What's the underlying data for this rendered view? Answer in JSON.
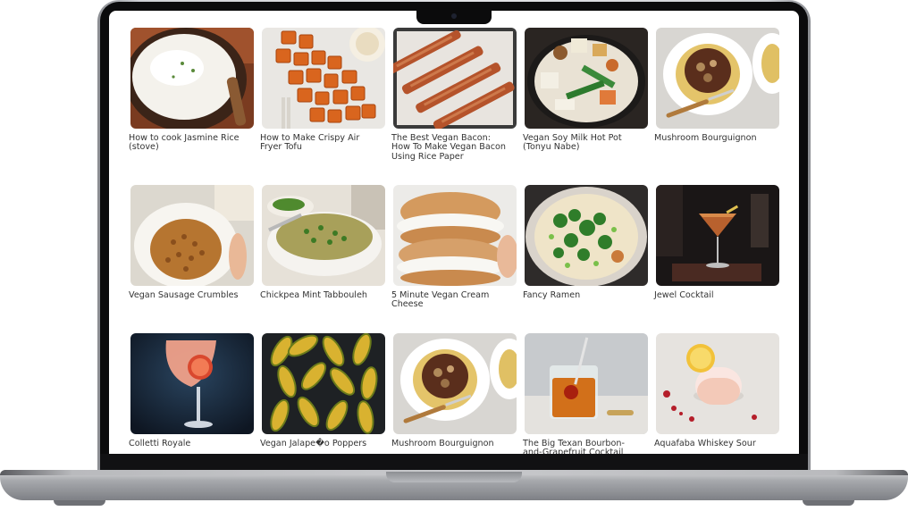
{
  "device": "laptop",
  "recipes": [
    {
      "title": "How to cook Jasmine Rice (stove)",
      "icon": "jasmine-rice-photo"
    },
    {
      "title": "How to Make Crispy Air Fryer Tofu",
      "icon": "crispy-tofu-photo"
    },
    {
      "title": "The Best Vegan Bacon: How To Make Vegan Bacon Using Rice Paper",
      "icon": "vegan-bacon-photo"
    },
    {
      "title": "Vegan Soy Milk Hot Pot (Tonyu Nabe)",
      "icon": "hot-pot-photo"
    },
    {
      "title": "Mushroom Bourguignon",
      "icon": "mushroom-bourguignon-photo"
    },
    {
      "title": "Vegan Sausage Crumbles",
      "icon": "sausage-crumbles-photo"
    },
    {
      "title": "Chickpea Mint Tabbouleh",
      "icon": "tabbouleh-photo"
    },
    {
      "title": "5 Minute Vegan Cream Cheese",
      "icon": "cream-cheese-bagel-photo"
    },
    {
      "title": "Fancy Ramen",
      "icon": "ramen-photo"
    },
    {
      "title": "Jewel Cocktail",
      "icon": "jewel-cocktail-photo"
    },
    {
      "title": "Colletti Royale",
      "icon": "colletti-royale-photo"
    },
    {
      "title": "Vegan Jalape�o Poppers",
      "icon": "jalapeno-poppers-photo"
    },
    {
      "title": "Mushroom Bourguignon",
      "icon": "mushroom-bourguignon-photo"
    },
    {
      "title": "The Big Texan Bourbon-and-Grapefruit Cocktail",
      "icon": "bourbon-cocktail-photo"
    },
    {
      "title": "Aquafaba Whiskey Sour",
      "icon": "whiskey-sour-photo"
    }
  ]
}
